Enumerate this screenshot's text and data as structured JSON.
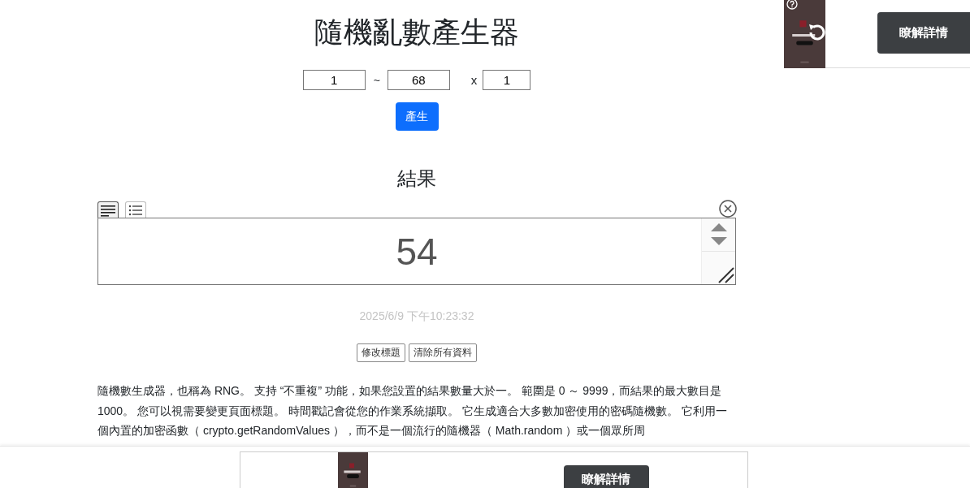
{
  "title": "隨機亂數產生器",
  "form": {
    "min": "1",
    "separator": "~",
    "max": "68",
    "times_label": "x",
    "count": "1",
    "generate_button": "產生"
  },
  "result": {
    "heading": "結果",
    "view_modes": [
      {
        "kind": "text",
        "selected": true
      },
      {
        "kind": "list",
        "selected": false
      }
    ],
    "value": "54",
    "timestamp": "2025/6/9 下午10:23:32"
  },
  "actions": [
    "修改標題",
    "清除所有資料"
  ],
  "description": "隨機數生成器，也稱為 RNG。 支持 “不重複” 功能，如果您設置的結果數量大於一。 範圍是 0 ～ 9999，而結果的最大數目是 1000。 您可以視需要變更頁面標題。 時間戳記會從您的作業系統擷取。 它生成適合大多數加密使用的密碼隨機數。 它利用一個內置的加密函數（ crypto.getRandomValues ），而不是一個流行的隨機器（ Math.random ）或一個眾所周",
  "side_ad": {
    "button": "瞭解詳情"
  },
  "bottom_ad": {
    "button": "瞭解詳情"
  }
}
